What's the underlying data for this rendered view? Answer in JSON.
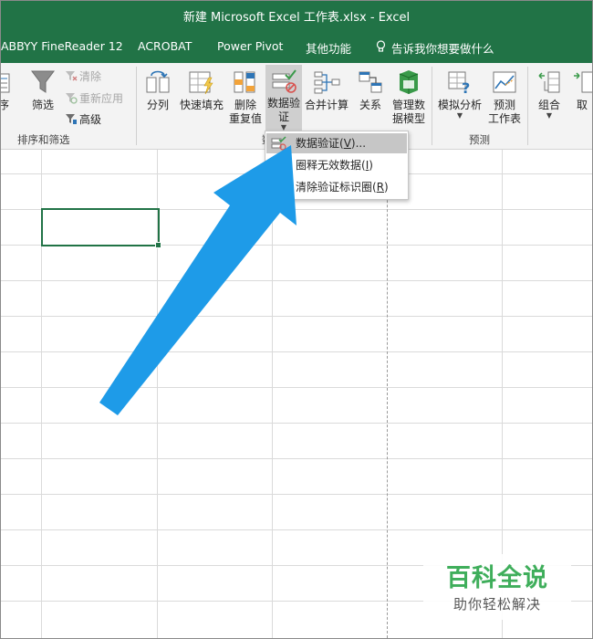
{
  "window": {
    "title": "新建 Microsoft Excel 工作表.xlsx  -  Excel"
  },
  "tabs": {
    "items": [
      {
        "label": "ABBYY FineReader 12"
      },
      {
        "label": "ACROBAT"
      },
      {
        "label": "Power Pivot"
      },
      {
        "label": "其他功能"
      }
    ],
    "tell_me": "告诉我你想要做什么"
  },
  "ribbon": {
    "sort_filter": {
      "group_label": "排序和筛选",
      "sort_cut_label": "序",
      "filter_label": "筛选",
      "clear_label": "清除",
      "reapply_label": "重新应用",
      "advanced_label": "高级"
    },
    "data_tools": {
      "group_label_fragment": "数",
      "text_to_columns_line1": "分列",
      "flash_fill": "快速填充",
      "remove_dup_line1": "删除",
      "remove_dup_line2": "重复值",
      "data_validation_line1": "数据验",
      "data_validation_line2": "证",
      "consolidate": "合并计算",
      "relationships": "关系",
      "manage_model_line1": "管理数",
      "manage_model_line2": "据模型"
    },
    "forecast": {
      "group_label": "预测",
      "what_if": "模拟分析",
      "forecast_sheet_line1": "预测",
      "forecast_sheet_line2": "工作表"
    },
    "outline": {
      "group_label": "组合",
      "ungroup_fragment": "取"
    }
  },
  "dropdown": {
    "items": [
      {
        "text": "数据验证(",
        "accel": "V",
        "after": ")..."
      },
      {
        "text": "圈释无效数据(",
        "accel": "I",
        "after": ")"
      },
      {
        "text": "清除验证标识圈(",
        "accel": "R",
        "after": ")"
      }
    ]
  },
  "colors": {
    "excel_green": "#217346",
    "arrow_blue": "#1e9be8",
    "watermark_green": "#3fae5b"
  },
  "watermark": {
    "title": "百科全说",
    "subtitle": "助你轻松解决"
  }
}
